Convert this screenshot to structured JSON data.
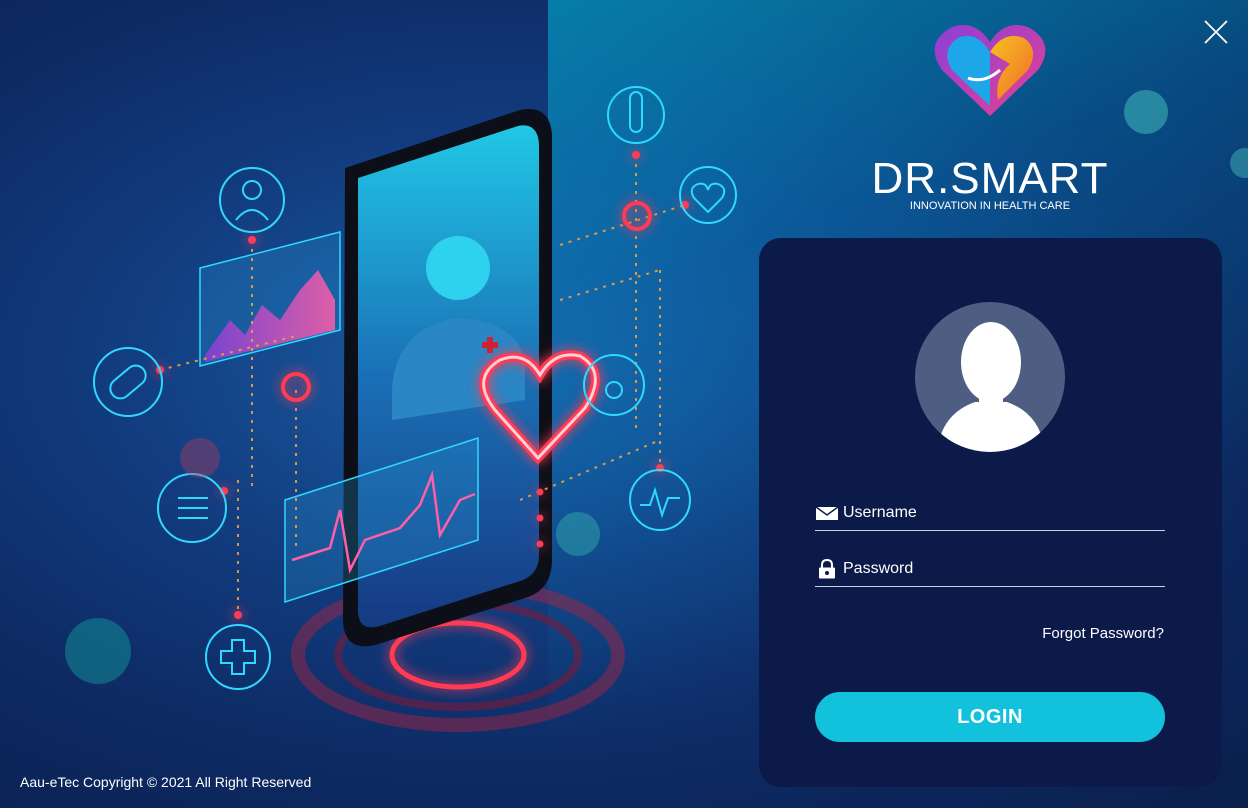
{
  "window": {
    "close_icon": "close-icon"
  },
  "brand": {
    "title": "DR.SMART",
    "subtitle": "INNOVATION IN HEALTH CARE",
    "logo_icon": "heart-hands-logo"
  },
  "login": {
    "avatar_icon": "user-avatar-icon",
    "username": {
      "icon": "envelope-icon",
      "placeholder": "Username",
      "value": ""
    },
    "password": {
      "icon": "lock-icon",
      "placeholder": "Password",
      "value": ""
    },
    "forgot_label": "Forgot Password?",
    "login_label": "LOGIN"
  },
  "footer": {
    "copyright": "Aau-eTec Copyright © 2021 All Right Reserved"
  },
  "colors": {
    "accent": "#12c2dc",
    "panel": "#0b1a49",
    "avatar_bg": "#4e5e83",
    "neon_red": "#ff3b52",
    "neon_cyan": "#2fd8ff"
  }
}
